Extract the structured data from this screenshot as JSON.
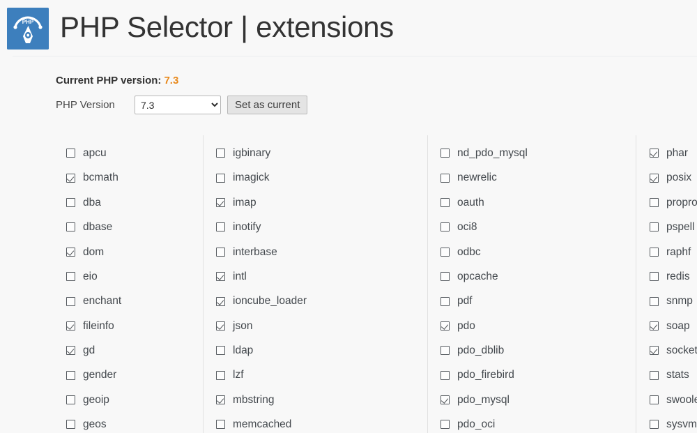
{
  "header": {
    "logo_icon": "php-gauge-logo-icon",
    "title": "PHP Selector | extensions"
  },
  "version_panel": {
    "current_label": "Current PHP version:",
    "current_value": "7.3",
    "accent_color": "#e8881a",
    "select_label": "PHP Version",
    "select_value": "7.3",
    "select_options": [
      "7.3"
    ],
    "set_button_label": "Set as current"
  },
  "extensions": {
    "columns": [
      {
        "items": [
          {
            "name": "apcu",
            "checked": false
          },
          {
            "name": "bcmath",
            "checked": true
          },
          {
            "name": "dba",
            "checked": false
          },
          {
            "name": "dbase",
            "checked": false
          },
          {
            "name": "dom",
            "checked": true
          },
          {
            "name": "eio",
            "checked": false
          },
          {
            "name": "enchant",
            "checked": false
          },
          {
            "name": "fileinfo",
            "checked": true
          },
          {
            "name": "gd",
            "checked": true
          },
          {
            "name": "gender",
            "checked": false
          },
          {
            "name": "geoip",
            "checked": false
          },
          {
            "name": "geos",
            "checked": false
          }
        ]
      },
      {
        "items": [
          {
            "name": "igbinary",
            "checked": false
          },
          {
            "name": "imagick",
            "checked": false
          },
          {
            "name": "imap",
            "checked": true
          },
          {
            "name": "inotify",
            "checked": false
          },
          {
            "name": "interbase",
            "checked": false
          },
          {
            "name": "intl",
            "checked": true
          },
          {
            "name": "ioncube_loader",
            "checked": true
          },
          {
            "name": "json",
            "checked": true
          },
          {
            "name": "ldap",
            "checked": false
          },
          {
            "name": "lzf",
            "checked": false
          },
          {
            "name": "mbstring",
            "checked": true
          },
          {
            "name": "memcached",
            "checked": false
          }
        ]
      },
      {
        "items": [
          {
            "name": "nd_pdo_mysql",
            "checked": false
          },
          {
            "name": "newrelic",
            "checked": false
          },
          {
            "name": "oauth",
            "checked": false
          },
          {
            "name": "oci8",
            "checked": false
          },
          {
            "name": "odbc",
            "checked": false
          },
          {
            "name": "opcache",
            "checked": false
          },
          {
            "name": "pdf",
            "checked": false
          },
          {
            "name": "pdo",
            "checked": true
          },
          {
            "name": "pdo_dblib",
            "checked": false
          },
          {
            "name": "pdo_firebird",
            "checked": false
          },
          {
            "name": "pdo_mysql",
            "checked": true
          },
          {
            "name": "pdo_oci",
            "checked": false
          }
        ]
      },
      {
        "items": [
          {
            "name": "phar",
            "checked": true
          },
          {
            "name": "posix",
            "checked": true
          },
          {
            "name": "propro",
            "checked": false
          },
          {
            "name": "pspell",
            "checked": false
          },
          {
            "name": "raphf",
            "checked": false
          },
          {
            "name": "redis",
            "checked": false
          },
          {
            "name": "snmp",
            "checked": false
          },
          {
            "name": "soap",
            "checked": true
          },
          {
            "name": "sockets",
            "checked": true
          },
          {
            "name": "stats",
            "checked": false
          },
          {
            "name": "swoole",
            "checked": false
          },
          {
            "name": "sysvmsg",
            "checked": false
          }
        ]
      }
    ]
  }
}
